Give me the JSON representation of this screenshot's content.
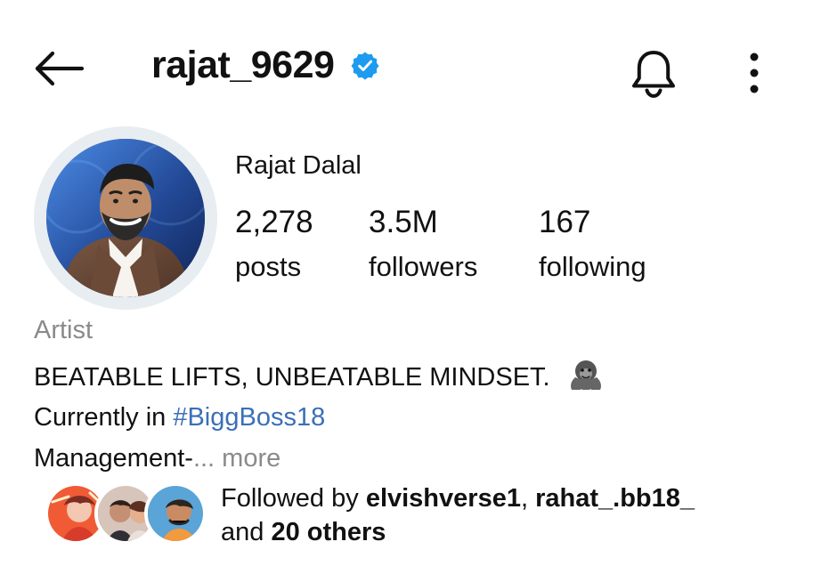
{
  "header": {
    "username": "rajat_9629"
  },
  "profile": {
    "display_name": "Rajat Dalal",
    "stats": [
      {
        "value": "2,278",
        "label": "posts"
      },
      {
        "value": "3.5M",
        "label": "followers"
      },
      {
        "value": "167",
        "label": "following"
      }
    ]
  },
  "bio": {
    "category": "Artist",
    "line1": "BEATABLE LIFTS, UNBEATABLE MINDSET.",
    "line2_prefix": "Currently in ",
    "hashtag": "#BiggBoss18",
    "line3_prefix": "Management-",
    "more_text": "... more"
  },
  "followed_by": {
    "prefix": "Followed by ",
    "user1": "elvishverse1",
    "separator": ", ",
    "user2": "rahat_.bb18_",
    "line2_prefix": "and ",
    "others": "20 others"
  },
  "icons": {
    "back": "arrow-left-icon",
    "verified": "verified-badge-icon",
    "notifications": "bell-icon",
    "more": "more-vertical-icon",
    "bio_emoji": "gorilla-emoji-icon"
  },
  "colors": {
    "verified_blue": "#1d9bf0",
    "hashtag": "#3b6fb6",
    "muted_text": "#8a8a8a",
    "avatar_ring": "#e8edf1"
  }
}
